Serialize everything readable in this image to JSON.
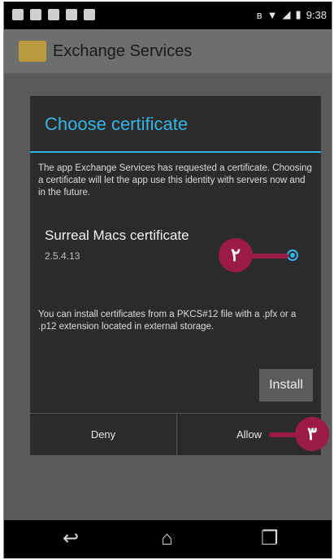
{
  "status_bar": {
    "time": "9:38"
  },
  "app": {
    "title": "Exchange Services"
  },
  "dialog": {
    "title": "Choose certificate",
    "message": "The app Exchange Services has requested a certificate. Choosing a certificate will let the app use this identity with servers now and in the future.",
    "certificate": {
      "name": "Surreal Macs certificate",
      "detail": "2.5.4.13",
      "selected": true
    },
    "note": "You can install certificates from a PKCS#12 file with a .pfx or a .p12 extension located in external storage.",
    "install_label": "Install",
    "deny_label": "Deny",
    "allow_label": "Allow"
  },
  "markers": {
    "radio_marker": "۲",
    "allow_marker": "۳"
  },
  "colors": {
    "accent": "#33b5e5",
    "marker": "#9b1b45"
  },
  "nav": {
    "back_icon": "back-icon",
    "home_icon": "home-icon",
    "recents_icon": "recents-icon"
  }
}
